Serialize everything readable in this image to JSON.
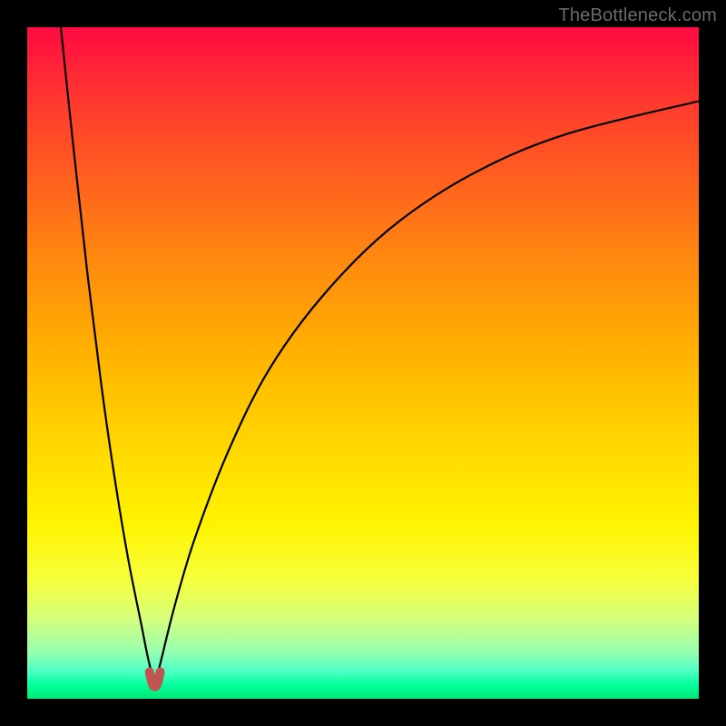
{
  "watermark": "TheBottleneck.com",
  "colors": {
    "frame": "#000000",
    "curve": "#000000",
    "minimum_marker": "#c0564f"
  },
  "chart_data": {
    "type": "line",
    "title": "",
    "xlabel": "",
    "ylabel": "",
    "xlim": [
      0,
      100
    ],
    "ylim": [
      0,
      100
    ],
    "grid": false,
    "legend": false,
    "annotations": [
      {
        "text": "TheBottleneck.com",
        "position": "top-right"
      }
    ],
    "minimum_x": 19,
    "series": [
      {
        "name": "left-branch",
        "x": [
          5,
          7,
          9,
          11,
          13,
          15,
          17,
          18,
          19
        ],
        "y": [
          100,
          81,
          63,
          47,
          33,
          21,
          11,
          6,
          2
        ]
      },
      {
        "name": "right-branch",
        "x": [
          19,
          20,
          22,
          25,
          30,
          36,
          44,
          54,
          66,
          80,
          100
        ],
        "y": [
          2,
          6,
          14,
          24,
          37,
          49,
          60,
          70,
          78,
          84,
          89
        ]
      },
      {
        "name": "minimum-marker",
        "x": [
          18.2,
          18.6,
          19,
          19.4,
          19.8
        ],
        "y": [
          4.0,
          2.3,
          1.8,
          2.3,
          4.0
        ]
      }
    ],
    "background_gradient_stops": [
      {
        "pos": 0.0,
        "color": "#ff0a42"
      },
      {
        "pos": 0.1,
        "color": "#ff3530"
      },
      {
        "pos": 0.22,
        "color": "#ff5e1f"
      },
      {
        "pos": 0.34,
        "color": "#ff8710"
      },
      {
        "pos": 0.48,
        "color": "#ffb000"
      },
      {
        "pos": 0.62,
        "color": "#ffd600"
      },
      {
        "pos": 0.74,
        "color": "#fff400"
      },
      {
        "pos": 0.82,
        "color": "#f7ff3a"
      },
      {
        "pos": 0.88,
        "color": "#d6ff7a"
      },
      {
        "pos": 0.93,
        "color": "#97ffb0"
      },
      {
        "pos": 0.96,
        "color": "#4cffc4"
      },
      {
        "pos": 0.98,
        "color": "#00ff99"
      },
      {
        "pos": 1.0,
        "color": "#00e676"
      }
    ]
  }
}
